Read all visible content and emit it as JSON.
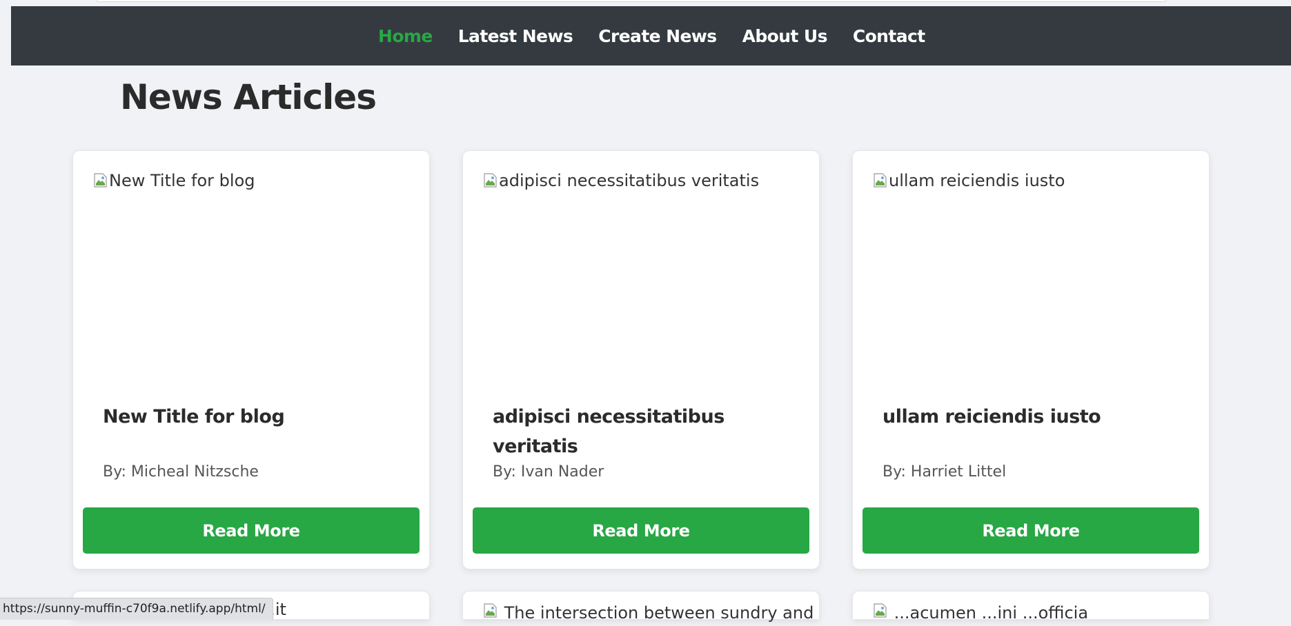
{
  "nav": {
    "items": [
      {
        "label": "Home",
        "active": true
      },
      {
        "label": "Latest News",
        "active": false
      },
      {
        "label": "Create News",
        "active": false
      },
      {
        "label": "About Us",
        "active": false
      },
      {
        "label": "Contact",
        "active": false
      }
    ]
  },
  "main": {
    "title": "News Articles",
    "articles": [
      {
        "image_alt": "New Title for blog",
        "title": "New Title for blog",
        "author": "By: Micheal Nitzsche",
        "button": "Read More"
      },
      {
        "image_alt": "adipisci necessitatibus veritatis",
        "title": "adipisci necessitatibus veritatis",
        "author": "By: Ivan Nader",
        "button": "Read More"
      },
      {
        "image_alt": "ullam reiciendis iusto",
        "title": "ullam reiciendis iusto",
        "author": "By: Harriet Littel",
        "button": "Read More"
      }
    ],
    "partial_row": [
      {
        "text": "...it"
      },
      {
        "text": "The intersection between sundry and"
      },
      {
        "text": "...acumen ...ini ...officia"
      }
    ]
  },
  "status_bar": {
    "url": "https://sunny-muffin-c70f9a.netlify.app/html/"
  },
  "colors": {
    "navbar": "#343a40",
    "accent": "#28a745",
    "background": "#f0f2f5"
  },
  "icons": {
    "broken_image": "broken-image-icon"
  }
}
